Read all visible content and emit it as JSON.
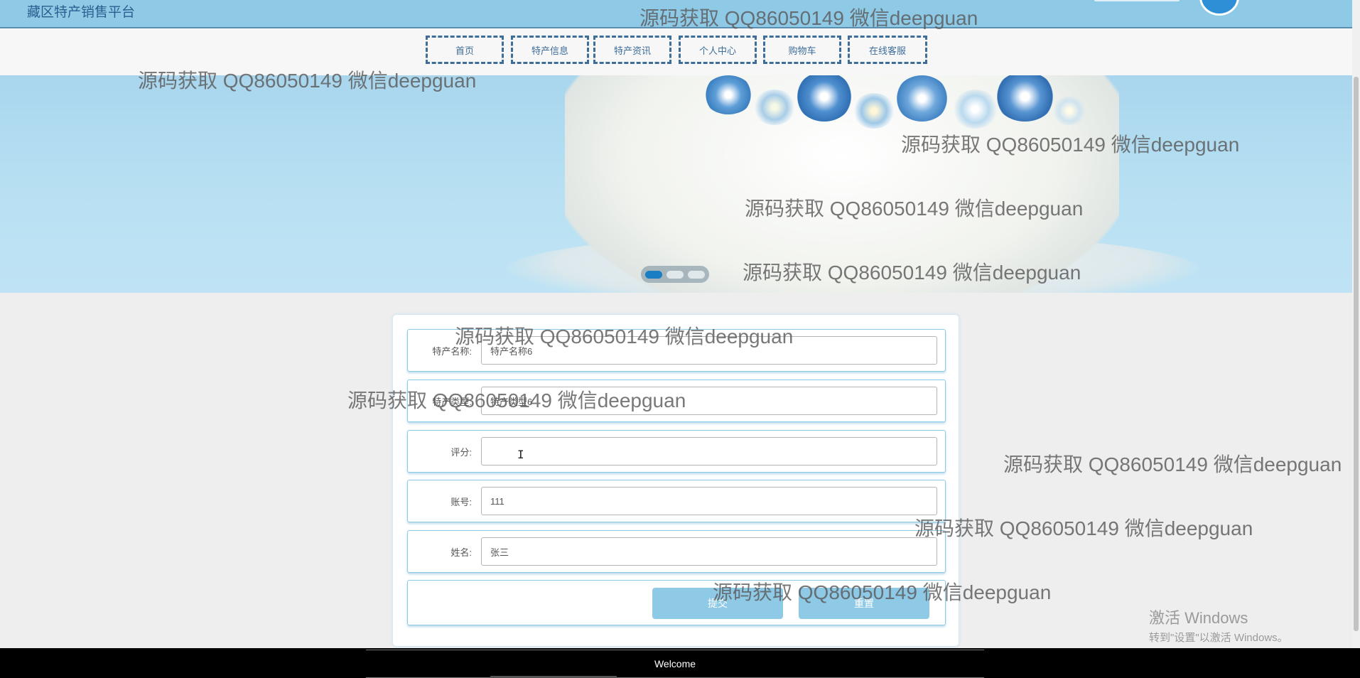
{
  "app": {
    "title": "藏区特产销售平台"
  },
  "nav": {
    "items": [
      {
        "label": "首页"
      },
      {
        "label": "特产信息"
      },
      {
        "label": "特产资讯"
      },
      {
        "label": "个人中心"
      },
      {
        "label": "购物车"
      },
      {
        "label": "在线客服"
      }
    ]
  },
  "carousel": {
    "slide_count": 3,
    "active_index": 0
  },
  "form": {
    "fields": [
      {
        "label": "特产名称:",
        "value": "特产名称6"
      },
      {
        "label": "特产类型:",
        "value": "特产类型6"
      },
      {
        "label": "评分:",
        "value": ""
      },
      {
        "label": "账号:",
        "value": "111"
      },
      {
        "label": "姓名:",
        "value": "张三"
      }
    ],
    "submit_label": "提交",
    "reset_label": "重置"
  },
  "footer": {
    "text": "Welcome"
  },
  "watermark": {
    "text": "源码获取 QQ86050149 微信deepguan"
  },
  "windows_activation": {
    "line1": "激活 Windows",
    "line2": "转到\"设置\"以激活 Windows。"
  },
  "colors": {
    "accent": "#8ec9e6",
    "nav_border": "#3d6d99",
    "active_dot": "#1a7ec4",
    "footer_bg": "#000000"
  }
}
